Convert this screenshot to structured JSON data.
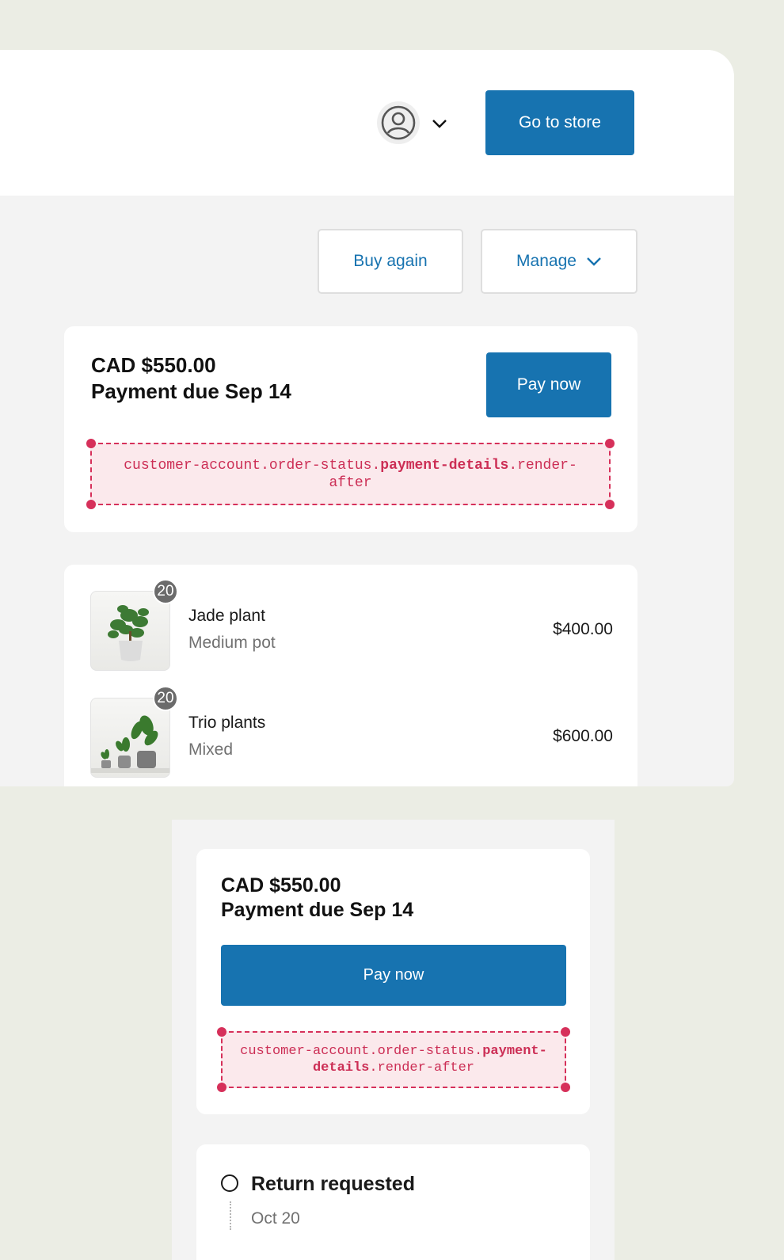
{
  "header": {
    "go_to_store": "Go to store",
    "avatar_icon": "user-circle-icon",
    "avatar_menu_icon": "chevron-down-icon"
  },
  "actions": {
    "buy_again": "Buy again",
    "manage": "Manage",
    "manage_icon": "chevron-down-icon"
  },
  "payment": {
    "amount": "CAD $550.00",
    "due": "Payment due Sep 14",
    "pay_now": "Pay now",
    "extension_target_pre": "customer-account.order-status.",
    "extension_target_bold": "payment-details",
    "extension_target_post": ".render-after"
  },
  "line_items": [
    {
      "name": "Jade plant",
      "variant": "Medium pot",
      "price": "$400.00",
      "quantity": "20"
    },
    {
      "name": "Trio plants",
      "variant": "Mixed",
      "price": "$600.00",
      "quantity": "20"
    }
  ],
  "mobile": {
    "amount": "CAD $550.00",
    "due": "Payment due Sep 14",
    "pay_now": "Pay now",
    "extension_target_pre": "customer-account.order-status.",
    "extension_target_bold": "payment-details",
    "extension_target_post": ".render-after",
    "return": {
      "title": "Return requested",
      "date": "Oct 20"
    }
  },
  "colors": {
    "accent": "#1773b0",
    "extension": "#d6305a",
    "extension_bg": "#fbe9ec",
    "page_bg": "#ebede4"
  }
}
